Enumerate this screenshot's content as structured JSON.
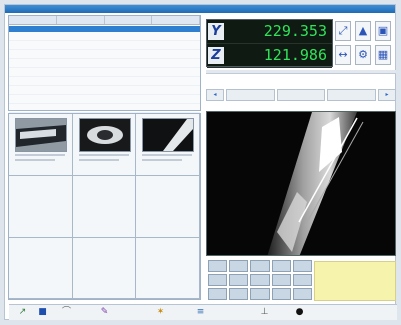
{
  "dro": {
    "axis1_label": "Y",
    "axis1_value": "229.353",
    "axis2_label": "Z",
    "axis2_value": "121.986"
  },
  "colors": {
    "dro_text": "#31e35a",
    "title_bar": "#1f6bb5",
    "selection_row": "#2f7fd0",
    "note_panel": "#f6f3ad"
  },
  "icons": [
    "zoom-icon",
    "probe-icon",
    "settings-icon",
    "camera-icon",
    "pointer-icon",
    "tool-icon",
    "light-icon",
    "measure-icon",
    "grid-icon",
    "stop-icon"
  ]
}
